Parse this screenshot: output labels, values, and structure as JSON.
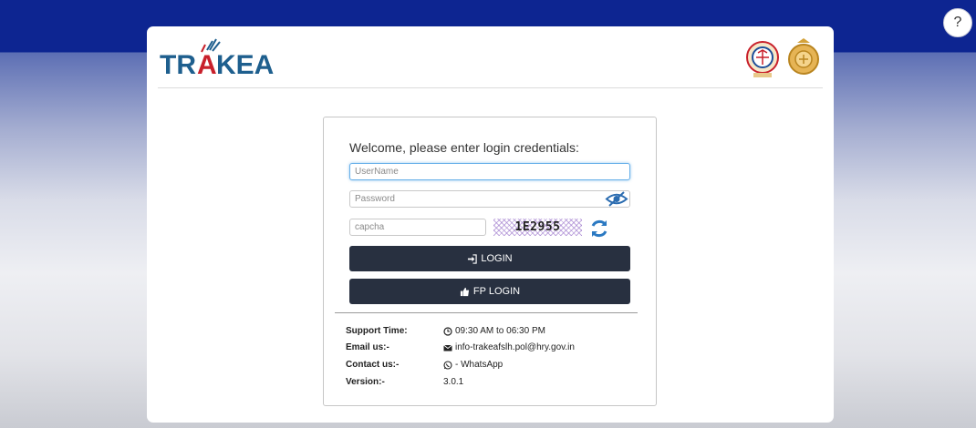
{
  "help": {
    "label": "?"
  },
  "header": {
    "logo_text": "TRAKEA",
    "emblem_left_text": "",
    "emblem_right_text": "",
    "colors": {
      "logo_blue": "#1e5f8e",
      "logo_red": "#c8202b",
      "bar": "#0d2591"
    }
  },
  "login": {
    "welcome": "Welcome, please enter login credentials:",
    "username_placeholder": "UserName",
    "password_placeholder": "Password",
    "captcha_placeholder": "capcha",
    "captcha_code": "1E2955",
    "login_label": "LOGIN",
    "fp_login_label": "FP LOGIN",
    "button_color": "#283040"
  },
  "info": {
    "support_label": "Support Time:",
    "support_value": "09:30 AM to 06:30 PM",
    "email_label": "Email us:-",
    "email_value": "info-trakeafslh.pol@hry.gov.in",
    "contact_label": "Contact us:-",
    "contact_value": "- WhatsApp",
    "version_label": "Version:-",
    "version_value": "3.0.1"
  }
}
